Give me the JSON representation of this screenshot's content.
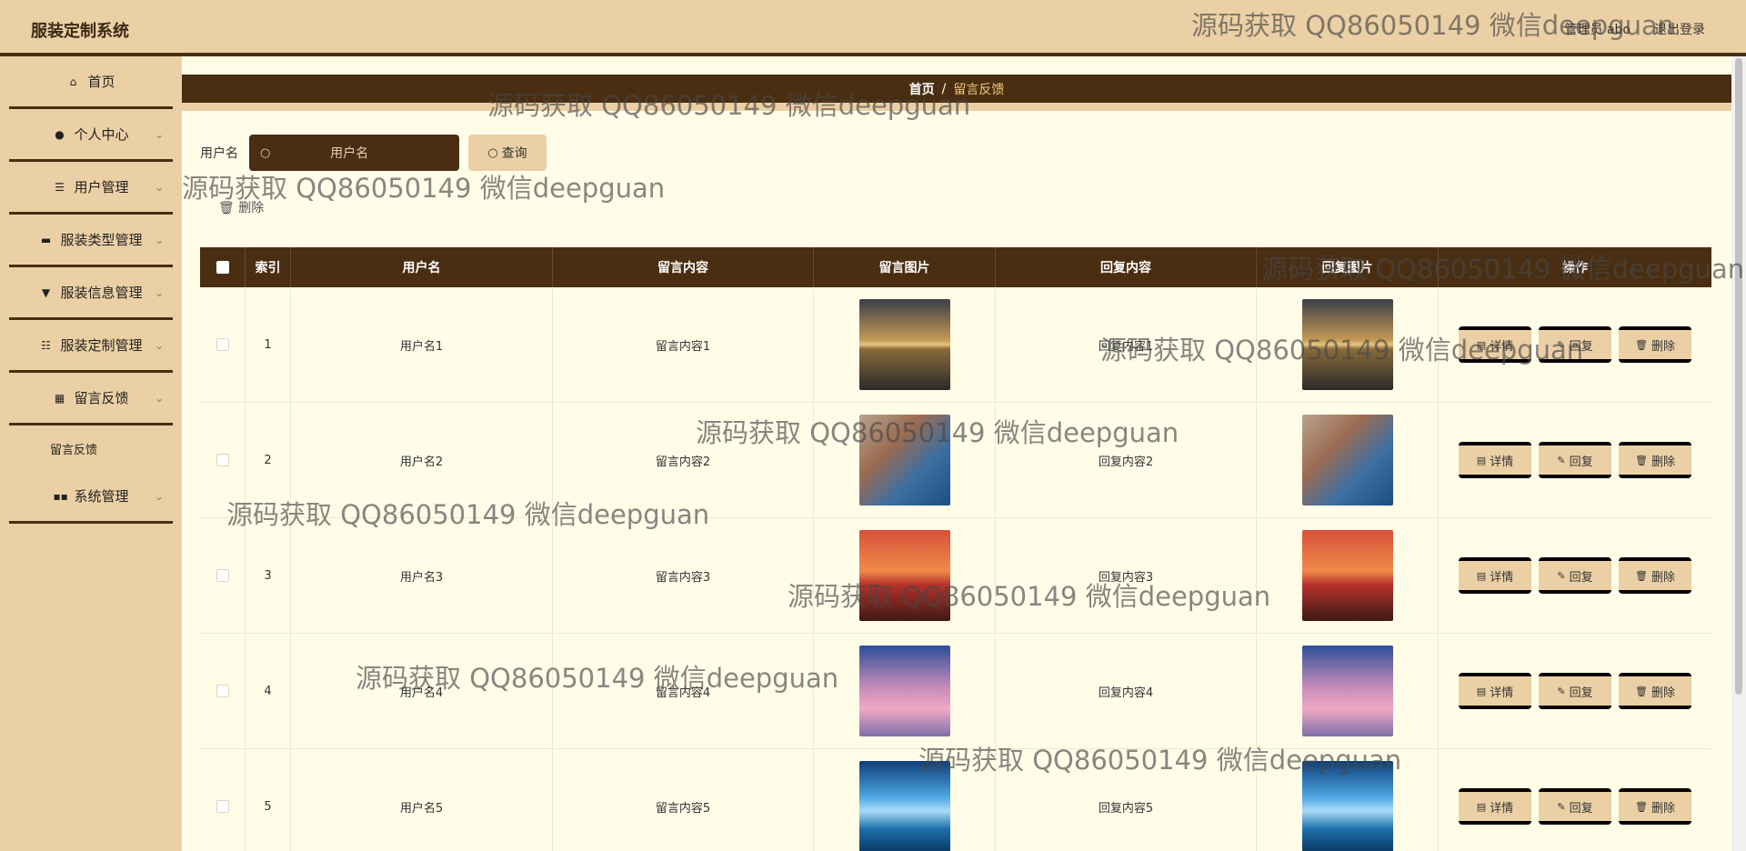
{
  "app": {
    "title": "服装定制系统"
  },
  "header": {
    "user_label": "管理员 abo",
    "logout_label": "退出登录"
  },
  "sidebar": {
    "items": [
      {
        "label": "首页",
        "icon": "home-icon",
        "has_chevron": false
      },
      {
        "label": "个人中心",
        "icon": "person-icon",
        "has_chevron": true
      },
      {
        "label": "用户管理",
        "icon": "sliders-icon",
        "has_chevron": true
      },
      {
        "label": "服装类型管理",
        "icon": "briefcase-icon",
        "has_chevron": true
      },
      {
        "label": "服装信息管理",
        "icon": "hanger-icon",
        "has_chevron": true
      },
      {
        "label": "服装定制管理",
        "icon": "list-icon",
        "has_chevron": true
      },
      {
        "label": "留言反馈",
        "icon": "grid-icon",
        "has_chevron": true
      },
      {
        "label": "系统管理",
        "icon": "apps-icon",
        "has_chevron": true
      }
    ],
    "submenu": {
      "label": "留言反馈"
    }
  },
  "breadcrumb": {
    "home": "首页",
    "separator": "/",
    "current": "留言反馈"
  },
  "search": {
    "label": "用户名",
    "placeholder": "用户名",
    "query_label": "查询"
  },
  "toolbar": {
    "delete_label": "删除"
  },
  "table": {
    "columns": [
      "索引",
      "用户名",
      "留言内容",
      "留言图片",
      "回复内容",
      "回复图片",
      "操作"
    ],
    "rows": [
      {
        "index": "1",
        "username": "用户名1",
        "message": "留言内容1",
        "image": "lake-tree",
        "reply": "回复内容1",
        "reply_image": "lake-tree"
      },
      {
        "index": "2",
        "username": "用户名2",
        "message": "留言内容2",
        "image": "coastal-town",
        "reply": "回复内容2",
        "reply_image": "coastal-town"
      },
      {
        "index": "3",
        "username": "用户名3",
        "message": "留言内容3",
        "image": "sunset",
        "reply": "回复内容3",
        "reply_image": "sunset"
      },
      {
        "index": "4",
        "username": "用户名4",
        "message": "留言内容4",
        "image": "pink-sky",
        "reply": "回复内容4",
        "reply_image": "pink-sky"
      },
      {
        "index": "5",
        "username": "用户名5",
        "message": "留言内容5",
        "image": "blue-lake",
        "reply": "回复内容5",
        "reply_image": "blue-lake"
      }
    ],
    "actions": {
      "detail": "详情",
      "reply": "回复",
      "delete": "删除"
    }
  },
  "watermark": {
    "text": "源码获取 QQ86050149 微信deepguan"
  },
  "colors": {
    "header_bg": "#ecd0a5",
    "dark_brown": "#4a2e12",
    "page_bg": "#fffde8",
    "crumb_active": "#f3c77a"
  }
}
